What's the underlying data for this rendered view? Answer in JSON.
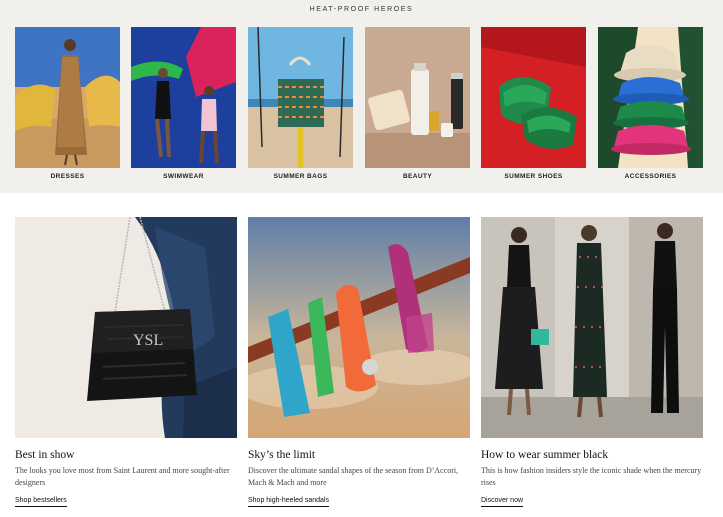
{
  "section_title": "HEAT-PROOF HEROES",
  "categories": [
    {
      "label": "DRESSES"
    },
    {
      "label": "SWIMWEAR"
    },
    {
      "label": "SUMMER BAGS"
    },
    {
      "label": "BEAUTY"
    },
    {
      "label": "SUMMER SHOES"
    },
    {
      "label": "ACCESSORIES"
    }
  ],
  "promos": [
    {
      "title": "Best in show",
      "description": "The looks you love most from Saint Laurent and more sought-after designers",
      "link": "Shop bestsellers"
    },
    {
      "title": "Sky’s the limit",
      "description": "Discover the ultimate sandal shapes of the season from D’Accori, Mach & Mach and more",
      "link": "Shop high-heeled sandals"
    },
    {
      "title": "How to wear summer black",
      "description": "This is how fashion insiders style the iconic shade when the mercury rises",
      "link": "Discover now"
    }
  ]
}
